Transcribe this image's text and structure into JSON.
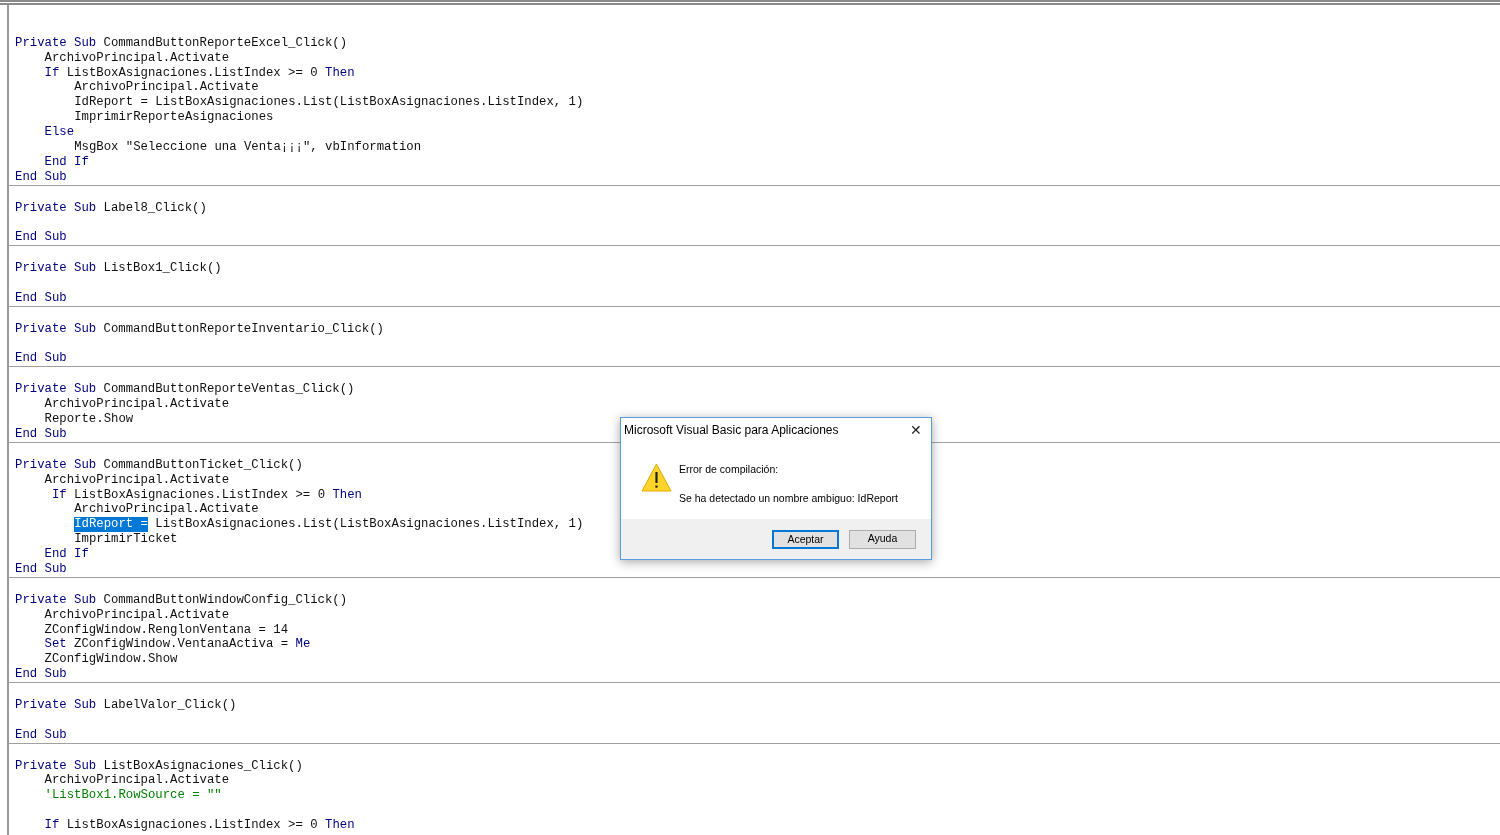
{
  "editor": {
    "procedures": [
      {
        "lines": [
          {
            "kind": "code",
            "tokens": [
              {
                "kind": "keyword",
                "text": "Private Sub"
              },
              {
                "kind": "text",
                "text": " CommandButtonReporteExcel_Click()"
              }
            ],
            "children": [
              {
                "kind": "code",
                "tokens": [
                  {
                    "kind": "text",
                    "text": "ArchivoPrincipal.Activate"
                  }
                ]
              },
              {
                "kind": "code",
                "tokens": [
                  {
                    "kind": "keyword",
                    "text": "If"
                  },
                  {
                    "kind": "text",
                    "text": " ListBoxAsignaciones.ListIndex >= 0 "
                  },
                  {
                    "kind": "keyword",
                    "text": "Then"
                  }
                ],
                "children": [
                  {
                    "kind": "code",
                    "tokens": [
                      {
                        "kind": "text",
                        "text": "ArchivoPrincipal.Activate"
                      }
                    ]
                  },
                  {
                    "kind": "code",
                    "tokens": [
                      {
                        "kind": "text",
                        "text": "IdReport = ListBoxAsignaciones.List(ListBoxAsignaciones.ListIndex, 1)"
                      }
                    ]
                  },
                  {
                    "kind": "code",
                    "tokens": [
                      {
                        "kind": "text",
                        "text": "ImprimirReporteAsignaciones"
                      }
                    ]
                  }
                ]
              },
              {
                "kind": "code",
                "tokens": [
                  {
                    "kind": "keyword",
                    "text": "Else"
                  }
                ],
                "children": [
                  {
                    "kind": "code",
                    "tokens": [
                      {
                        "kind": "text",
                        "text": "MsgBox \"Seleccione una Venta¡¡¡\", vbInformation"
                      }
                    ]
                  }
                ]
              },
              {
                "kind": "code",
                "tokens": [
                  {
                    "kind": "keyword",
                    "text": "End If"
                  }
                ]
              }
            ]
          },
          {
            "kind": "code",
            "tokens": [
              {
                "kind": "keyword",
                "text": "End Sub"
              }
            ]
          }
        ]
      },
      {
        "lines": [
          {
            "kind": "blank"
          },
          {
            "kind": "code",
            "tokens": [
              {
                "kind": "keyword",
                "text": "Private Sub"
              },
              {
                "kind": "text",
                "text": " Label8_Click()"
              }
            ]
          },
          {
            "kind": "blank"
          },
          {
            "kind": "code",
            "tokens": [
              {
                "kind": "keyword",
                "text": "End Sub"
              }
            ]
          }
        ]
      },
      {
        "lines": [
          {
            "kind": "blank"
          },
          {
            "kind": "code",
            "tokens": [
              {
                "kind": "keyword",
                "text": "Private Sub"
              },
              {
                "kind": "text",
                "text": " ListBox1_Click()"
              }
            ]
          },
          {
            "kind": "blank"
          },
          {
            "kind": "code",
            "tokens": [
              {
                "kind": "keyword",
                "text": "End Sub"
              }
            ]
          }
        ]
      },
      {
        "lines": [
          {
            "kind": "blank"
          },
          {
            "kind": "code",
            "tokens": [
              {
                "kind": "keyword",
                "text": "Private Sub"
              },
              {
                "kind": "text",
                "text": " CommandButtonReporteInventario_Click()"
              }
            ]
          },
          {
            "kind": "blank"
          },
          {
            "kind": "code",
            "tokens": [
              {
                "kind": "keyword",
                "text": "End Sub"
              }
            ]
          }
        ]
      },
      {
        "lines": [
          {
            "kind": "blank"
          },
          {
            "kind": "code",
            "tokens": [
              {
                "kind": "keyword",
                "text": "Private Sub"
              },
              {
                "kind": "text",
                "text": " CommandButtonReporteVentas_Click()"
              }
            ],
            "children": [
              {
                "kind": "code",
                "tokens": [
                  {
                    "kind": "text",
                    "text": "ArchivoPrincipal.Activate"
                  }
                ]
              },
              {
                "kind": "code",
                "tokens": [
                  {
                    "kind": "text",
                    "text": "Reporte.Show"
                  }
                ]
              }
            ]
          },
          {
            "kind": "code",
            "tokens": [
              {
                "kind": "keyword",
                "text": "End Sub"
              }
            ]
          }
        ]
      },
      {
        "lines": [
          {
            "kind": "blank"
          },
          {
            "kind": "code",
            "tokens": [
              {
                "kind": "keyword",
                "text": "Private Sub"
              },
              {
                "kind": "text",
                "text": " CommandButtonTicket_Click()"
              }
            ],
            "children": [
              {
                "kind": "code",
                "tokens": [
                  {
                    "kind": "text",
                    "text": "ArchivoPrincipal.Activate"
                  }
                ]
              },
              {
                "kind": "code",
                "tokens": [
                  {
                    "kind": "keyword",
                    "text": " If"
                  },
                  {
                    "kind": "text",
                    "text": " ListBoxAsignaciones.ListIndex >= 0 "
                  },
                  {
                    "kind": "keyword",
                    "text": "Then"
                  }
                ],
                "children": [
                  {
                    "kind": "code",
                    "tokens": [
                      {
                        "kind": "text",
                        "text": "ArchivoPrincipal.Activate"
                      }
                    ]
                  },
                  {
                    "kind": "code",
                    "tokens": [
                      {
                        "kind": "selection",
                        "text": "IdReport ="
                      },
                      {
                        "kind": "text",
                        "text": " ListBoxAsignaciones.List(ListBoxAsignaciones.ListIndex, 1)"
                      }
                    ]
                  },
                  {
                    "kind": "code",
                    "tokens": [
                      {
                        "kind": "text",
                        "text": "ImprimirTicket"
                      }
                    ]
                  }
                ]
              },
              {
                "kind": "code",
                "tokens": [
                  {
                    "kind": "keyword",
                    "text": "End If"
                  }
                ]
              }
            ]
          },
          {
            "kind": "code",
            "tokens": [
              {
                "kind": "keyword",
                "text": "End Sub"
              }
            ]
          }
        ]
      },
      {
        "lines": [
          {
            "kind": "blank"
          },
          {
            "kind": "code",
            "tokens": [
              {
                "kind": "keyword",
                "text": "Private Sub"
              },
              {
                "kind": "text",
                "text": " CommandButtonWindowConfig_Click()"
              }
            ],
            "children": [
              {
                "kind": "code",
                "tokens": [
                  {
                    "kind": "text",
                    "text": "ArchivoPrincipal.Activate"
                  }
                ]
              },
              {
                "kind": "code",
                "tokens": [
                  {
                    "kind": "text",
                    "text": "ZConfigWindow.RenglonVentana = 14"
                  }
                ]
              },
              {
                "kind": "code",
                "tokens": [
                  {
                    "kind": "keyword",
                    "text": "Set"
                  },
                  {
                    "kind": "text",
                    "text": " ZConfigWindow.VentanaActiva = "
                  },
                  {
                    "kind": "keyword",
                    "text": "Me"
                  }
                ]
              },
              {
                "kind": "code",
                "tokens": [
                  {
                    "kind": "text",
                    "text": "ZConfigWindow.Show"
                  }
                ]
              }
            ]
          },
          {
            "kind": "code",
            "tokens": [
              {
                "kind": "keyword",
                "text": "End Sub"
              }
            ]
          }
        ]
      },
      {
        "lines": [
          {
            "kind": "blank"
          },
          {
            "kind": "code",
            "tokens": [
              {
                "kind": "keyword",
                "text": "Private Sub"
              },
              {
                "kind": "text",
                "text": " LabelValor_Click()"
              }
            ]
          },
          {
            "kind": "blank"
          },
          {
            "kind": "code",
            "tokens": [
              {
                "kind": "keyword",
                "text": "End Sub"
              }
            ]
          }
        ]
      },
      {
        "lines": [
          {
            "kind": "blank"
          },
          {
            "kind": "code",
            "tokens": [
              {
                "kind": "keyword",
                "text": "Private Sub"
              },
              {
                "kind": "text",
                "text": " ListBoxAsignaciones_Click()"
              }
            ],
            "children": [
              {
                "kind": "code",
                "tokens": [
                  {
                    "kind": "text",
                    "text": "ArchivoPrincipal.Activate"
                  }
                ]
              },
              {
                "kind": "code",
                "tokens": [
                  {
                    "kind": "comment",
                    "text": "'ListBox1.RowSource = \"\""
                  }
                ]
              },
              {
                "kind": "blank"
              },
              {
                "kind": "code",
                "tokens": [
                  {
                    "kind": "keyword",
                    "text": "If"
                  },
                  {
                    "kind": "text",
                    "text": " ListBoxAsignaciones.ListIndex >= 0 "
                  },
                  {
                    "kind": "keyword",
                    "text": "Then"
                  }
                ]
              }
            ]
          }
        ]
      }
    ]
  },
  "dialog": {
    "title": "Microsoft Visual Basic para Aplicaciones",
    "close": "✕",
    "heading": "Error de compilación:",
    "message": "Se ha detectado un nombre ambiguo: IdReport",
    "buttons": [
      {
        "label": "Aceptar",
        "selected": true
      },
      {
        "label": "Ayuda",
        "selected": false
      }
    ]
  }
}
